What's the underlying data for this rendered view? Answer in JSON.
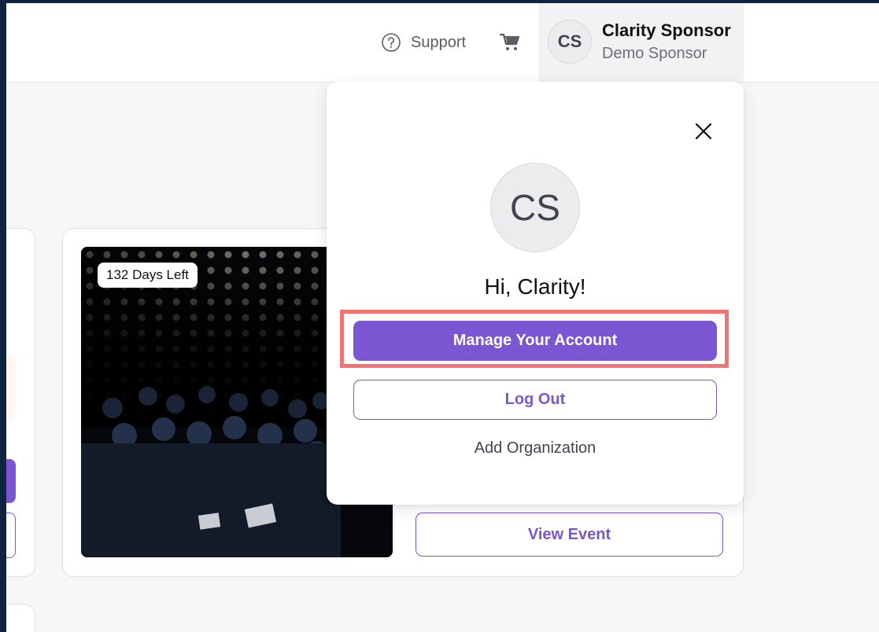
{
  "header": {
    "support_label": "Support",
    "support_icon": "question-circle-icon",
    "cart_icon": "cart-icon",
    "user": {
      "initials": "CS",
      "name": "Clarity Sponsor",
      "organization": "Demo Sponsor"
    }
  },
  "event_card": {
    "days_left_badge": "132 Days Left",
    "view_event_label": "View Event"
  },
  "account_menu": {
    "close_icon": "close-icon",
    "initials": "CS",
    "greeting": "Hi, Clarity!",
    "manage_account_label": "Manage Your Account",
    "logout_label": "Log Out",
    "add_organization_label": "Add Organization"
  },
  "colors": {
    "accent": "#7b56d2",
    "highlight": "#f37373",
    "frame": "#0d2541"
  }
}
